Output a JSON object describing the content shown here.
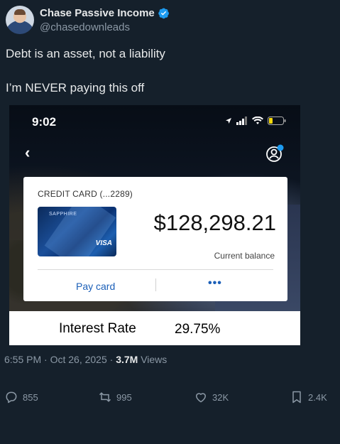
{
  "author": {
    "display_name": "Chase Passive Income",
    "handle": "@chasedownleads",
    "verified": true
  },
  "tweet": {
    "line1": "Debt is an asset, not a liability",
    "line2": "I’m NEVER paying this off"
  },
  "media": {
    "phone_time": "9:02",
    "card_title": "CREDIT CARD (...2289)",
    "card_brand": "SAPPHIRE",
    "card_network": "VISA",
    "balance": "$128,298.21",
    "balance_label": "Current balance",
    "pay_button": "Pay card",
    "more_button": "•••",
    "interest_label": "Interest Rate",
    "interest_value": "29.75%"
  },
  "meta": {
    "timestamp": "6:55 PM · Oct 26, 2025 · ",
    "views_count": "3.7M",
    "views_label": " Views"
  },
  "actions": {
    "replies": "855",
    "reposts": "995",
    "likes": "32K",
    "bookmarks": "2.4K"
  },
  "colors": {
    "background": "#15202b",
    "verified_badge": "#1d9bf0",
    "link_blue": "#1b5fb8"
  }
}
